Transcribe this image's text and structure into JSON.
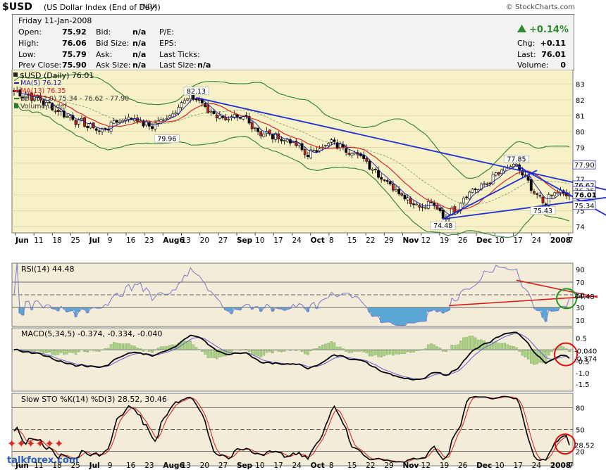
{
  "header": {
    "symbol": "$USD",
    "name": "(US Dollar Index (End of Day))",
    "exchange": "INDX",
    "brand": "© StockCharts.com"
  },
  "quote": {
    "date": "Friday  11-Jan-2008",
    "open_label": "Open:",
    "open": "75.92",
    "high_label": "High:",
    "high": "76.06",
    "low_label": "Low:",
    "low": "75.79",
    "prev_label": "Prev Close:",
    "prev": "75.90",
    "bid_label": "Bid:",
    "bid": "n/a",
    "bidsize_label": "Bid Size:",
    "bidsize": "n/a",
    "ask_label": "Ask:",
    "ask": "n/a",
    "asksize_label": "Ask Size:",
    "asksize": "n/a",
    "pe_label": "P/E:",
    "eps_label": "EPS:",
    "lastticks_label": "Last Ticks:",
    "lastsize_label": "Last Size:",
    "lastsize": "n/a",
    "pct_change": "+0.14%",
    "chg_label": "Chg:",
    "chg": "+0.11",
    "last_label": "Last:",
    "last": "76.01",
    "volume_label": "Volume:",
    "volume": "0"
  },
  "colors": {
    "price_bg": "#f6f1c6",
    "ind_bg": "#f3ecd9",
    "ma5": "#1a1aa6",
    "ma13": "#d31c1c",
    "bb": "#2e7d2e",
    "trend": "#1f2fd1",
    "rsi_line": "#7a79c9",
    "rsi_fill": "#5aa6d6",
    "hist": "#a8cf84",
    "circle_red": "#e11010",
    "circle_green": "#1d9a1d",
    "sto_k": "#000000",
    "sto_d": "#d31c1c"
  },
  "chart_data": [
    {
      "type": "candlestick",
      "title": "$USD (Daily) 76.01",
      "legend": [
        "MA(5) 76.12",
        "MA(13) 76.35",
        "BB(26,2.0) 75.34 - 76.62 - 77.90",
        "Volume undef"
      ],
      "ylim": [
        73.6,
        83.9
      ],
      "y_ticks": [
        74,
        75,
        76,
        77,
        78,
        79,
        80,
        81,
        82,
        83
      ],
      "x_labels": [
        "Jun",
        "11",
        "18",
        "25",
        "Jul",
        "9",
        "16",
        "23",
        "Aug6",
        "13",
        "20",
        "27",
        "Sep",
        "10",
        "17",
        "24",
        "Oct",
        "8",
        "15",
        "22",
        "29",
        "Nov",
        "12",
        "19",
        "26",
        "Dec",
        "10",
        "17",
        "24",
        "2008",
        "7"
      ],
      "close_key": [
        [
          0,
          82.5
        ],
        [
          8,
          82.1
        ],
        [
          14,
          81.4
        ],
        [
          22,
          80.6
        ],
        [
          30,
          80.0
        ],
        [
          34,
          80.6
        ],
        [
          40,
          80.9
        ],
        [
          46,
          80.3
        ],
        [
          53,
          81.0
        ],
        [
          58,
          82.0
        ],
        [
          62,
          82.13
        ],
        [
          66,
          81.3
        ],
        [
          72,
          80.8
        ],
        [
          79,
          80.8
        ],
        [
          83,
          80.0
        ],
        [
          90,
          79.6
        ],
        [
          95,
          79.3
        ],
        [
          100,
          78.5
        ],
        [
          104,
          79.0
        ],
        [
          108,
          79.3
        ],
        [
          113,
          78.9
        ],
        [
          119,
          78.3
        ],
        [
          124,
          77.3
        ],
        [
          129,
          76.5
        ],
        [
          135,
          75.6
        ],
        [
          139,
          75.2
        ],
        [
          142,
          75.5
        ],
        [
          146,
          74.6
        ],
        [
          148,
          74.8
        ],
        [
          151,
          75.2
        ],
        [
          154,
          76.1
        ],
        [
          160,
          76.6
        ],
        [
          165,
          77.4
        ],
        [
          168,
          77.7
        ],
        [
          171,
          77.85
        ],
        [
          174,
          77.0
        ],
        [
          177,
          76.0
        ],
        [
          181,
          75.5
        ],
        [
          184,
          76.2
        ],
        [
          188,
          76.01
        ]
      ],
      "annotations": [
        {
          "label": "82.13",
          "x": 62,
          "y": 82.13
        },
        {
          "label": "79.96",
          "x": 52,
          "y": 79.96
        },
        {
          "label": "77.85",
          "x": 171,
          "y": 77.85
        },
        {
          "label": "74.48",
          "x": 146,
          "y": 74.48
        },
        {
          "label": "75.43",
          "x": 180,
          "y": 75.43
        }
      ],
      "right_labels": [
        {
          "label": "77.90",
          "y": 77.9
        },
        {
          "label": "76.62",
          "y": 76.62
        },
        {
          "label": "76.35",
          "y": 76.35
        },
        {
          "label": "76.01",
          "y": 76.01
        },
        {
          "label": "75.34",
          "y": 75.34
        }
      ],
      "trend_lines": [
        {
          "x": [
            62,
            190
          ],
          "y": [
            82.13,
            76.8
          ]
        },
        {
          "x": [
            146,
            190
          ],
          "y": [
            74.48,
            75.55
          ]
        },
        {
          "x": [
            146,
            178
          ],
          "y": [
            74.48,
            77.55
          ]
        },
        {
          "x": [
            171,
            190
          ],
          "y": [
            77.85,
            75.9
          ]
        }
      ]
    },
    {
      "type": "line",
      "title": "RSI(14) 44.48",
      "ylim": [
        0,
        100
      ],
      "y_ticks": [
        10,
        30,
        50,
        70,
        90
      ],
      "right_labels": [
        "44.48"
      ],
      "trend_lines": [
        {
          "x": [
            148,
            190
          ],
          "y": [
            33,
            48
          ]
        },
        {
          "x": [
            171,
            190
          ],
          "y": [
            73,
            46
          ]
        }
      ]
    },
    {
      "type": "line",
      "title": "MACD(5,34,5) -0.374, -0.334, -0.040",
      "ylim": [
        -1.8,
        0.95
      ],
      "y_ticks": [
        -1.5,
        -1.0,
        -0.5,
        0.0,
        0.5
      ],
      "tick_labels": [
        "-1.5",
        "-1.0",
        "-0.5",
        "",
        "0.5"
      ],
      "right_labels": [
        "-0.040",
        "-0.374"
      ]
    },
    {
      "type": "line",
      "title": "Slow STO %K(14) %D(3) 28.52, 30.46",
      "ylim": [
        0,
        100
      ],
      "y_ticks": [
        20,
        50,
        80
      ],
      "right_labels": [
        "28.52"
      ],
      "watermark": "talkforex.com"
    }
  ]
}
